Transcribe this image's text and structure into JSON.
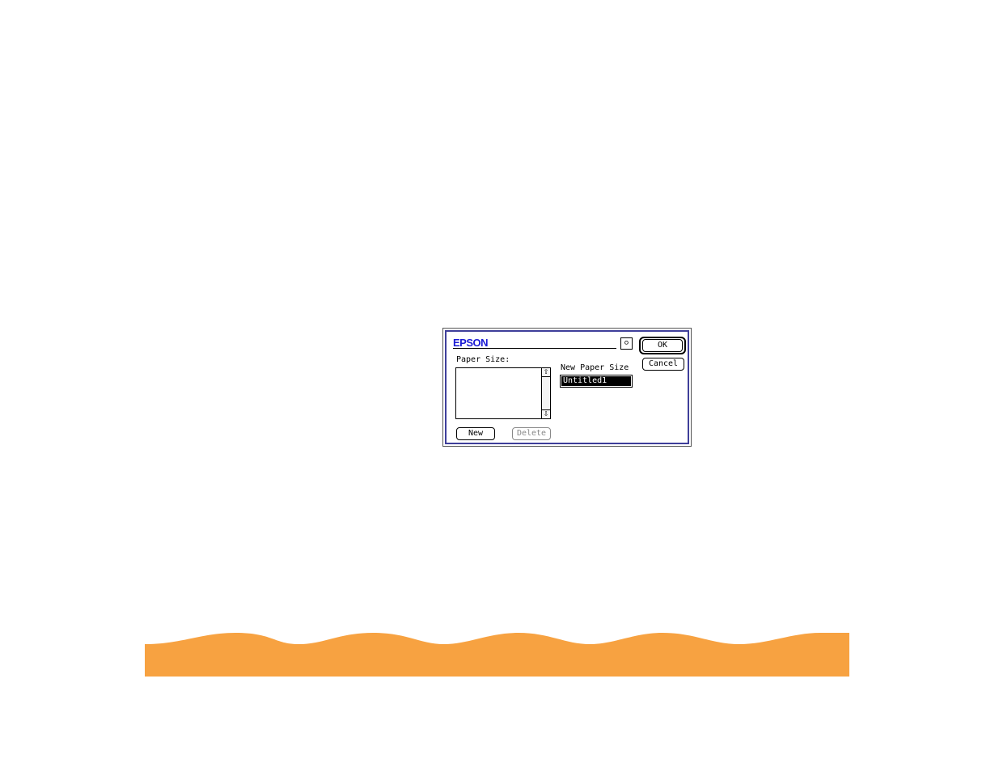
{
  "dialog": {
    "brand": "EPSON",
    "help_icon": "help-balloon-icon",
    "ok_label": "OK",
    "cancel_label": "Cancel",
    "paper_size_label": "Paper Size:",
    "paper_size_items": [],
    "new_button_label": "New",
    "delete_button_label": "Delete",
    "new_paper_size_label": "New Paper Size",
    "new_paper_size_value": "Untitled1"
  },
  "colors": {
    "brand": "#1b1bd6",
    "dialog_border": "#3f3f9a",
    "wave": "#f7a241"
  }
}
